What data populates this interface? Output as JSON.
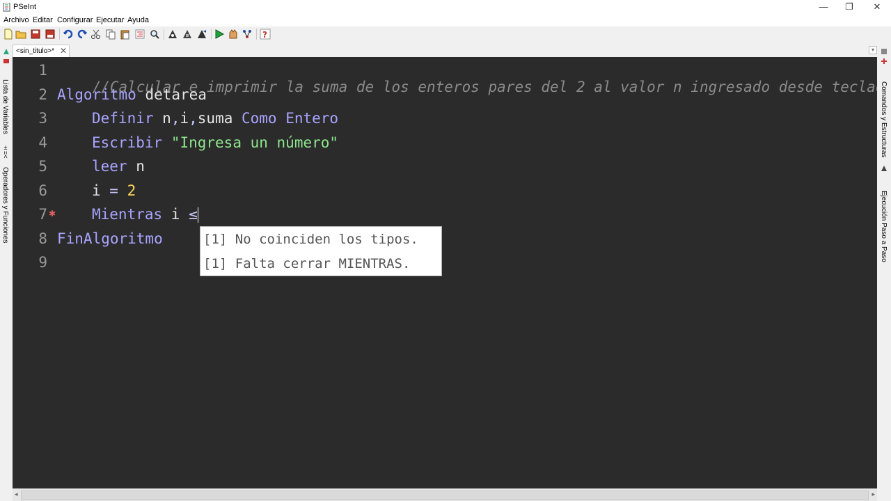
{
  "window": {
    "title": "PSeInt",
    "minimize": "—",
    "restore": "❐",
    "close": "✕"
  },
  "menu": {
    "items": [
      "Archivo",
      "Editar",
      "Configurar",
      "Ejecutar",
      "Ayuda"
    ]
  },
  "toolbar": {
    "icons": [
      "new-file-icon",
      "open-folder-icon",
      "save-icon",
      "save-as-icon",
      "undo-icon",
      "redo-icon",
      "cut-icon",
      "copy-icon",
      "paste-icon",
      "indent-icon",
      "find-icon",
      "zoom-icon",
      "flowchart-icon",
      "code-icon",
      "debug-icon",
      "run-icon",
      "step-icon",
      "diagram-icon",
      "help-icon"
    ]
  },
  "tab": {
    "label": "<sin_titulo>*",
    "close": "✕",
    "dropdown": "▾"
  },
  "left_panel": {
    "variables": "Lista de Variables",
    "operators": "Operadores y Funciones"
  },
  "right_panel": {
    "commands": "Comandos y Estructuras",
    "step": "Ejecución Paso a Paso"
  },
  "editor": {
    "line_numbers": [
      "1",
      "2",
      "3",
      "4",
      "5",
      "6",
      "7",
      "8",
      "9"
    ],
    "error_marker": "✱",
    "line1": "//Calcular e imprimir la suma de los enteros pares del 2 al valor n ingresado desde teclado",
    "line2_kw": "Algoritmo",
    "line2_name": " detarea",
    "line3_kw1": "Definir",
    "line3_vars1": " n",
    "line3_c1": ",",
    "line3_vars2": "i",
    "line3_c2": ",",
    "line3_vars3": "suma ",
    "line3_kw2": "Como Entero",
    "line4_kw": "Escribir",
    "line4_str": "\"Ingresa un número\"",
    "line5_kw": "leer",
    "line5_var": " n",
    "line6_var": "i ",
    "line6_op": "=",
    "line6_num": "2",
    "line7_kw": "Mientras",
    "line7_var": " i ",
    "line7_op": "≤",
    "line8_kw": "FinAlgoritmo"
  },
  "tooltip": {
    "line1": "[1] No coinciden los tipos.",
    "line2": "[1] Falta cerrar MIENTRAS."
  },
  "colors": {
    "editor_bg": "#2b2b2b",
    "keyword": "#a9a4ff",
    "comment": "#8a8a8a",
    "string": "#8ee68e",
    "number": "#ffd75a"
  }
}
